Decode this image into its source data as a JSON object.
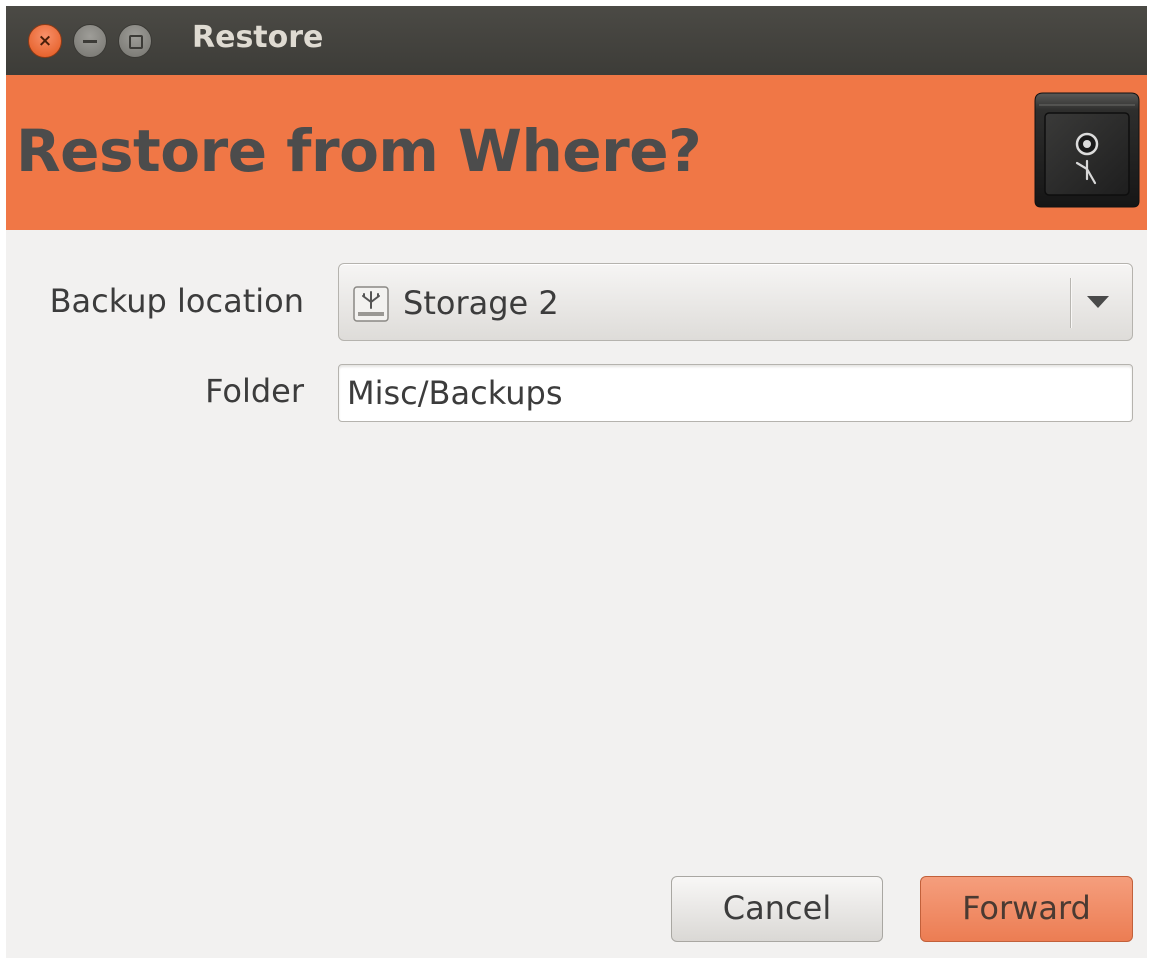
{
  "window": {
    "title": "Restore",
    "buttons": {
      "close_glyph": "×"
    }
  },
  "header": {
    "title": "Restore from Where?",
    "icon": "safe-icon",
    "accent_color": "#f07746"
  },
  "form": {
    "backup_location": {
      "label": "Backup location",
      "value": "Storage 2",
      "icon": "drive-icon"
    },
    "folder": {
      "label": "Folder",
      "value": "Misc/Backups"
    }
  },
  "actions": {
    "cancel_label": "Cancel",
    "forward_label": "Forward"
  }
}
